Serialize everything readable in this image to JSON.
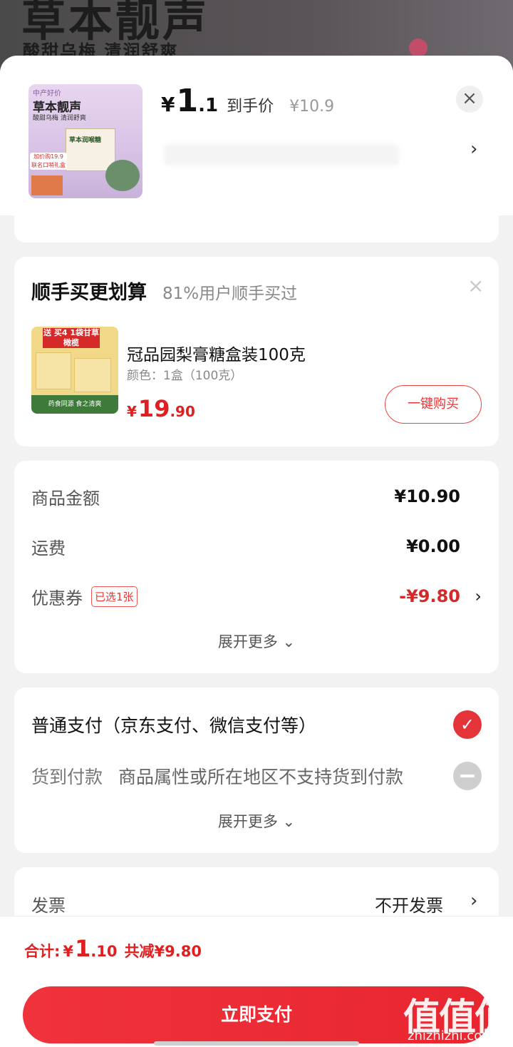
{
  "background": {
    "title": "草本靓声",
    "subtitle": "酸甜乌梅 清润舒爽"
  },
  "header": {
    "thumb": {
      "brand_line": "中产好价",
      "title": "草本靓声",
      "tagline": "酸甜乌梅 清润舒爽",
      "box_label": "草本润喉糖",
      "promo_line1": "加价购19.9",
      "promo_line2": "联名口哨礼盒"
    },
    "currency": "¥",
    "price_int": "1",
    "price_dec": ".1",
    "price_label": "到手价",
    "original_price": "¥10.9",
    "close_icon": "×",
    "chevron": "›"
  },
  "addon": {
    "title": "顺手买更划算",
    "subtitle": "81%用户顺手买过",
    "close_icon": "×",
    "thumb_badge": "送 买4 1袋甘草橄榄",
    "thumb_footer": "药食同源 食之清爽",
    "product_name": "冠品园梨膏糖盒装100克",
    "attribute": "颜色：1盒（100克）",
    "currency": "¥",
    "price_int": "19",
    "price_dec": ".90",
    "buy_button": "一键购买"
  },
  "amount": {
    "rows": [
      {
        "label": "商品金额",
        "value": "¥10.90"
      },
      {
        "label": "运费",
        "value": "¥0.00"
      },
      {
        "label": "优惠券",
        "tag": "已选1张",
        "value": "-¥9.80"
      }
    ],
    "expand": "展开更多",
    "chevron": "›",
    "expand_icon": "⌄"
  },
  "payment": {
    "option1": "普通支付（京东支付、微信支付等）",
    "option2_label": "货到付款",
    "option2_note": "商品属性或所在地区不支持货到付款",
    "expand": "展开更多",
    "check_icon": "✓"
  },
  "invoice": {
    "label": "发票",
    "value": "不开发票",
    "chevron": "›"
  },
  "bottom": {
    "total_label": "合计:",
    "currency": "¥",
    "total_int": "1",
    "total_dec": ".10",
    "savings": "共减¥9.80",
    "pay_button": "立即支付"
  },
  "watermark": {
    "big": "值值值",
    "small": "zhizhizhi.com"
  },
  "colors": {
    "accent_red": "#e5333a",
    "price_red": "#e02020",
    "background": "#f2f2f2"
  }
}
